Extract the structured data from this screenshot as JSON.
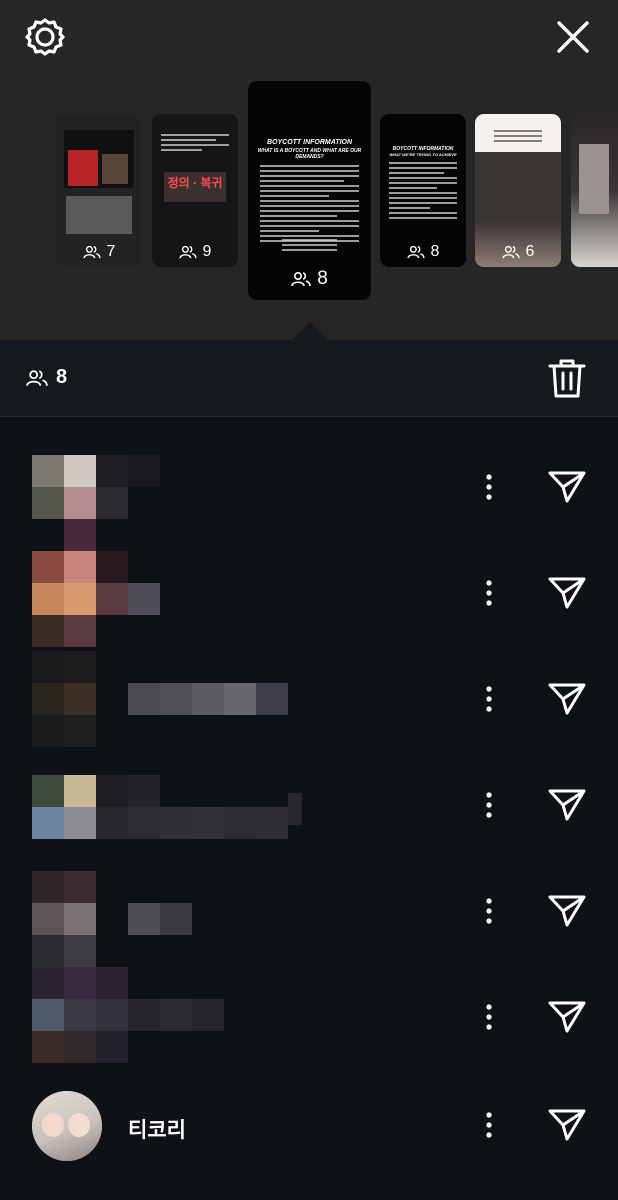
{
  "header": {
    "settings_icon": "gear-icon",
    "close_icon": "close-icon"
  },
  "stories": [
    {
      "viewer_count": "7"
    },
    {
      "viewer_count": "9",
      "overlay_text": "정의 · 복귀"
    },
    {
      "viewer_count": "8",
      "title": "BOYCOTT INFORMATION",
      "subtitle": "WHAT IS A BOYCOTT AND WHAT ARE OUR DEMANDS?",
      "selected": true
    },
    {
      "viewer_count": "8",
      "title": "BOYCOTT INFORMATION",
      "subtitle": "WHAT WE'RE TRYING TO ACHIEVE"
    },
    {
      "viewer_count": "6"
    },
    {
      "viewer_count": ""
    }
  ],
  "viewers_bar": {
    "count": "8",
    "viewers_icon": "people-icon",
    "delete_icon": "trash-icon"
  },
  "viewers": [
    {
      "username": ""
    },
    {
      "username": ""
    },
    {
      "username": ""
    },
    {
      "username": ""
    },
    {
      "username": ""
    },
    {
      "username": ""
    },
    {
      "username": "티코리"
    }
  ],
  "colors": {
    "top_background": "#262626",
    "list_background": "#0e1116",
    "bar_background": "#15181d",
    "foreground": "#ffffff"
  }
}
